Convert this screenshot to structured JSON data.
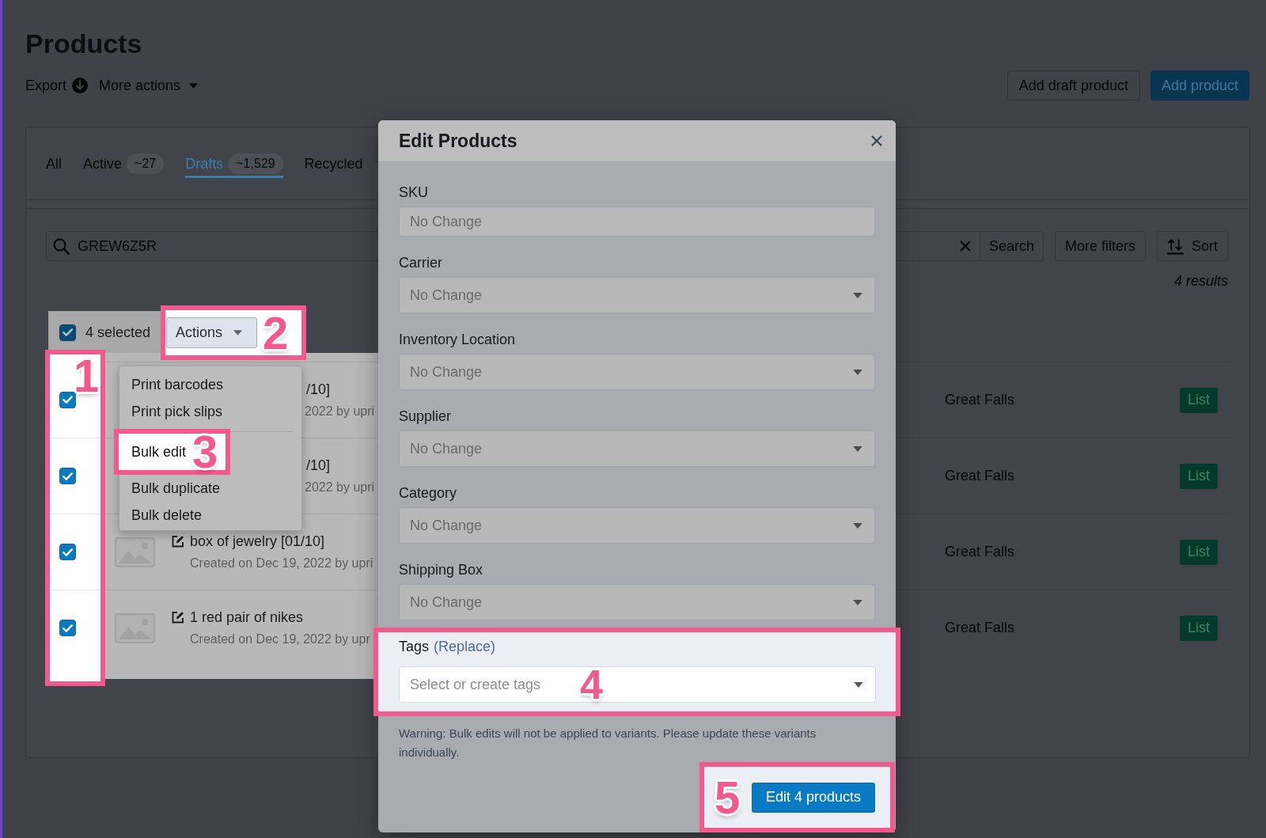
{
  "page": {
    "title": "Products",
    "export": "Export",
    "more_actions": "More actions",
    "buttons": [
      {
        "label": "Add draft product",
        "kind": "secondary"
      },
      {
        "label": "Add product",
        "kind": "primary"
      }
    ]
  },
  "tabs": [
    {
      "label": "All",
      "selected": false
    },
    {
      "label": "Active",
      "count": "~27",
      "selected": false
    },
    {
      "label": "Drafts",
      "count": "~1,529",
      "selected": true
    },
    {
      "label": "Recycled",
      "selected": false
    }
  ],
  "filters": {
    "search_value": "GREW6Z5R",
    "search_button": "Search",
    "more_filters": "More filters",
    "sort": "Sort",
    "results": "4 results"
  },
  "bulk_bar": {
    "checked": true,
    "label": "4 selected",
    "actions": "Actions",
    "callout": "2"
  },
  "action_menu": {
    "groups": [
      {
        "items": [
          {
            "label": "Print barcodes"
          },
          {
            "label": "Print pick slips"
          }
        ]
      },
      {
        "items": [
          {
            "label": "Bulk edit",
            "callout": "3"
          },
          {
            "label": "Bulk duplicate"
          },
          {
            "label": "Bulk delete"
          }
        ]
      }
    ]
  },
  "list": {
    "checkbox_callout": "1",
    "rows": [
      {
        "kind": "partial",
        "checked": true,
        "title": "/10]",
        "subtitle": "2022 by upri",
        "location": "Great Falls",
        "action": "List"
      },
      {
        "kind": "partial",
        "checked": true,
        "title": "/10]",
        "subtitle": "2022 by upri",
        "location": "Great Falls",
        "action": "List"
      },
      {
        "kind": "full",
        "checked": true,
        "title": "box of jewelry [01/10]",
        "subtitle": "Created on Dec 19, 2022 by upri",
        "location": "Great Falls",
        "action": "List"
      },
      {
        "kind": "full",
        "checked": true,
        "title": "1 red pair of nikes",
        "subtitle": "Created on Dec 19, 2022 by upr",
        "location": "Great Falls",
        "action": "List"
      }
    ]
  },
  "dialog": {
    "title": "Edit Products",
    "fields": [
      {
        "label": "SKU",
        "kind": "text",
        "placeholder": "No Change"
      },
      {
        "label": "Carrier",
        "kind": "select",
        "placeholder": "No Change"
      },
      {
        "label": "Inventory Location",
        "kind": "select",
        "placeholder": "No Change"
      },
      {
        "label": "Supplier",
        "kind": "select",
        "placeholder": "No Change"
      },
      {
        "label": "Category",
        "kind": "select",
        "placeholder": "No Change"
      },
      {
        "label": "Shipping Box",
        "kind": "select",
        "placeholder": "No Change"
      }
    ],
    "tags": {
      "label": "Tags",
      "note": "(Replace)",
      "placeholder": "Select or create tags",
      "callout": "4"
    },
    "warning": "Warning: Bulk edits will not be applied to variants. Please update these variants individually.",
    "submit": {
      "label": "Edit 4 products",
      "callout": "5"
    }
  }
}
